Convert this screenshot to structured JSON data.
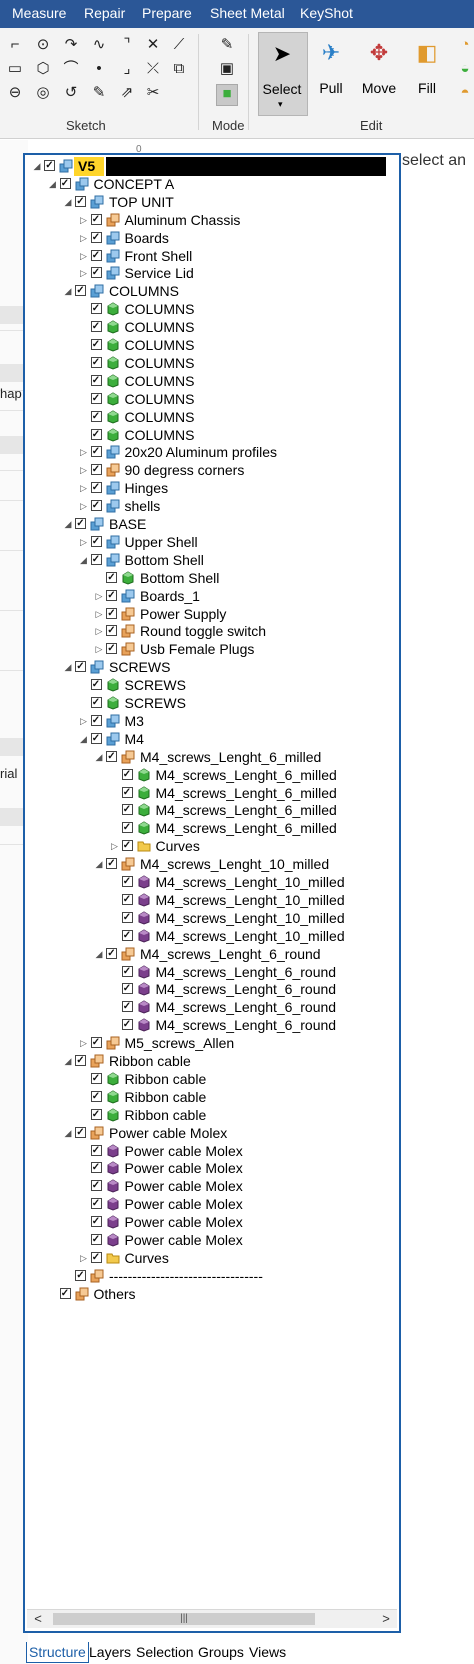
{
  "menu": [
    "Measure",
    "Repair",
    "Prepare",
    "Sheet Metal",
    "KeyShot"
  ],
  "ribbon": {
    "groups": [
      "Sketch",
      "Mode",
      "Edit"
    ],
    "buttons": [
      "Select",
      "Pull",
      "Move",
      "Fill"
    ]
  },
  "left_panel_fragments": [
    "hap",
    "rial"
  ],
  "ruler_mark": "0",
  "canvas_hint": "select an",
  "tree": [
    {
      "label": "V5",
      "level": 0,
      "expander": "open",
      "icon": "assembly-blue",
      "bold": true,
      "redacted": true
    },
    {
      "label": "CONCEPT A",
      "level": 1,
      "expander": "open",
      "icon": "assembly-blue"
    },
    {
      "label": "TOP UNIT",
      "level": 2,
      "expander": "open",
      "icon": "assembly-blue"
    },
    {
      "label": "Aluminum Chassis",
      "level": 3,
      "expander": "closed",
      "icon": "assembly-orange"
    },
    {
      "label": "Boards",
      "level": 3,
      "expander": "closed",
      "icon": "assembly-blue"
    },
    {
      "label": "Front Shell",
      "level": 3,
      "expander": "closed",
      "icon": "assembly-blue"
    },
    {
      "label": "Service Lid",
      "level": 3,
      "expander": "closed",
      "icon": "assembly-blue"
    },
    {
      "label": "COLUMNS",
      "level": 2,
      "expander": "open",
      "icon": "assembly-blue"
    },
    {
      "label": "COLUMNS",
      "level": 3,
      "expander": "none",
      "icon": "body-green"
    },
    {
      "label": "COLUMNS",
      "level": 3,
      "expander": "none",
      "icon": "body-green"
    },
    {
      "label": "COLUMNS",
      "level": 3,
      "expander": "none",
      "icon": "body-green"
    },
    {
      "label": "COLUMNS",
      "level": 3,
      "expander": "none",
      "icon": "body-green"
    },
    {
      "label": "COLUMNS",
      "level": 3,
      "expander": "none",
      "icon": "body-green"
    },
    {
      "label": "COLUMNS",
      "level": 3,
      "expander": "none",
      "icon": "body-green"
    },
    {
      "label": "COLUMNS",
      "level": 3,
      "expander": "none",
      "icon": "body-green"
    },
    {
      "label": "COLUMNS",
      "level": 3,
      "expander": "none",
      "icon": "body-green"
    },
    {
      "label": "20x20 Aluminum profiles",
      "level": 3,
      "expander": "closed",
      "icon": "assembly-blue"
    },
    {
      "label": "90 degress corners",
      "level": 3,
      "expander": "closed",
      "icon": "assembly-orange"
    },
    {
      "label": "Hinges",
      "level": 3,
      "expander": "closed",
      "icon": "assembly-blue"
    },
    {
      "label": "shells",
      "level": 3,
      "expander": "closed",
      "icon": "assembly-blue"
    },
    {
      "label": "BASE",
      "level": 2,
      "expander": "open",
      "icon": "assembly-blue"
    },
    {
      "label": "Upper Shell",
      "level": 3,
      "expander": "closed",
      "icon": "assembly-blue"
    },
    {
      "label": "Bottom Shell",
      "level": 3,
      "expander": "open",
      "icon": "assembly-blue"
    },
    {
      "label": "Bottom Shell",
      "level": 4,
      "expander": "none",
      "icon": "body-green"
    },
    {
      "label": "Boards_1",
      "level": 4,
      "expander": "closed",
      "icon": "assembly-blue"
    },
    {
      "label": "Power Supply",
      "level": 4,
      "expander": "closed",
      "icon": "assembly-orange"
    },
    {
      "label": "Round toggle switch",
      "level": 4,
      "expander": "closed",
      "icon": "assembly-orange"
    },
    {
      "label": "Usb Female Plugs",
      "level": 4,
      "expander": "closed",
      "icon": "assembly-orange"
    },
    {
      "label": "SCREWS",
      "level": 2,
      "expander": "open",
      "icon": "assembly-blue"
    },
    {
      "label": "SCREWS",
      "level": 3,
      "expander": "none",
      "icon": "body-green"
    },
    {
      "label": "SCREWS",
      "level": 3,
      "expander": "none",
      "icon": "body-green"
    },
    {
      "label": "M3",
      "level": 3,
      "expander": "closed",
      "icon": "assembly-blue"
    },
    {
      "label": "M4",
      "level": 3,
      "expander": "open",
      "icon": "assembly-blue"
    },
    {
      "label": "M4_screws_Lenght_6_milled",
      "level": 4,
      "expander": "open",
      "icon": "assembly-orange"
    },
    {
      "label": "M4_screws_Lenght_6_milled",
      "level": 5,
      "expander": "none",
      "icon": "body-green"
    },
    {
      "label": "M4_screws_Lenght_6_milled",
      "level": 5,
      "expander": "none",
      "icon": "body-green"
    },
    {
      "label": "M4_screws_Lenght_6_milled",
      "level": 5,
      "expander": "none",
      "icon": "body-green"
    },
    {
      "label": "M4_screws_Lenght_6_milled",
      "level": 5,
      "expander": "none",
      "icon": "body-green"
    },
    {
      "label": "Curves",
      "level": 5,
      "expander": "closed",
      "icon": "folder"
    },
    {
      "label": "M4_screws_Lenght_10_milled",
      "level": 4,
      "expander": "open",
      "icon": "assembly-orange"
    },
    {
      "label": "M4_screws_Lenght_10_milled",
      "level": 5,
      "expander": "none",
      "icon": "body-purple"
    },
    {
      "label": "M4_screws_Lenght_10_milled",
      "level": 5,
      "expander": "none",
      "icon": "body-purple"
    },
    {
      "label": "M4_screws_Lenght_10_milled",
      "level": 5,
      "expander": "none",
      "icon": "body-purple"
    },
    {
      "label": "M4_screws_Lenght_10_milled",
      "level": 5,
      "expander": "none",
      "icon": "body-purple"
    },
    {
      "label": "M4_screws_Lenght_6_round",
      "level": 4,
      "expander": "open",
      "icon": "assembly-orange"
    },
    {
      "label": "M4_screws_Lenght_6_round",
      "level": 5,
      "expander": "none",
      "icon": "body-purple"
    },
    {
      "label": "M4_screws_Lenght_6_round",
      "level": 5,
      "expander": "none",
      "icon": "body-purple"
    },
    {
      "label": "M4_screws_Lenght_6_round",
      "level": 5,
      "expander": "none",
      "icon": "body-purple"
    },
    {
      "label": "M4_screws_Lenght_6_round",
      "level": 5,
      "expander": "none",
      "icon": "body-purple"
    },
    {
      "label": "M5_screws_Allen",
      "level": 3,
      "expander": "closed",
      "icon": "assembly-orange"
    },
    {
      "label": "Ribbon cable",
      "level": 2,
      "expander": "open",
      "icon": "assembly-orange"
    },
    {
      "label": "Ribbon cable",
      "level": 3,
      "expander": "none",
      "icon": "body-green"
    },
    {
      "label": "Ribbon cable",
      "level": 3,
      "expander": "none",
      "icon": "body-green"
    },
    {
      "label": "Ribbon cable",
      "level": 3,
      "expander": "none",
      "icon": "body-green"
    },
    {
      "label": "Power cable Molex",
      "level": 2,
      "expander": "open",
      "icon": "assembly-orange"
    },
    {
      "label": "Power cable Molex",
      "level": 3,
      "expander": "none",
      "icon": "body-purple"
    },
    {
      "label": "Power cable Molex",
      "level": 3,
      "expander": "none",
      "icon": "body-purple"
    },
    {
      "label": "Power cable Molex",
      "level": 3,
      "expander": "none",
      "icon": "body-purple"
    },
    {
      "label": "Power cable Molex",
      "level": 3,
      "expander": "none",
      "icon": "body-purple"
    },
    {
      "label": "Power cable Molex",
      "level": 3,
      "expander": "none",
      "icon": "body-purple"
    },
    {
      "label": "Power cable Molex",
      "level": 3,
      "expander": "none",
      "icon": "body-purple"
    },
    {
      "label": "Curves",
      "level": 3,
      "expander": "closed",
      "icon": "folder"
    },
    {
      "label": "---------------------------------",
      "level": 2,
      "expander": "none",
      "icon": "assembly-orange"
    },
    {
      "label": "Others",
      "level": 1,
      "expander": "none",
      "icon": "assembly-orange"
    }
  ],
  "bottom_tabs": [
    "Structure",
    "Layers",
    "Selection",
    "Groups",
    "Views"
  ],
  "colors": {
    "menubar": "#2b5797",
    "panel_border": "#1d5fa8",
    "root_highlight": "#ffd52b",
    "body_green": "#3cae3c",
    "body_purple": "#7b3f8c",
    "assembly_blue": "#5a9fd4",
    "assembly_orange": "#e8a25a",
    "folder": "#f2c94c"
  }
}
